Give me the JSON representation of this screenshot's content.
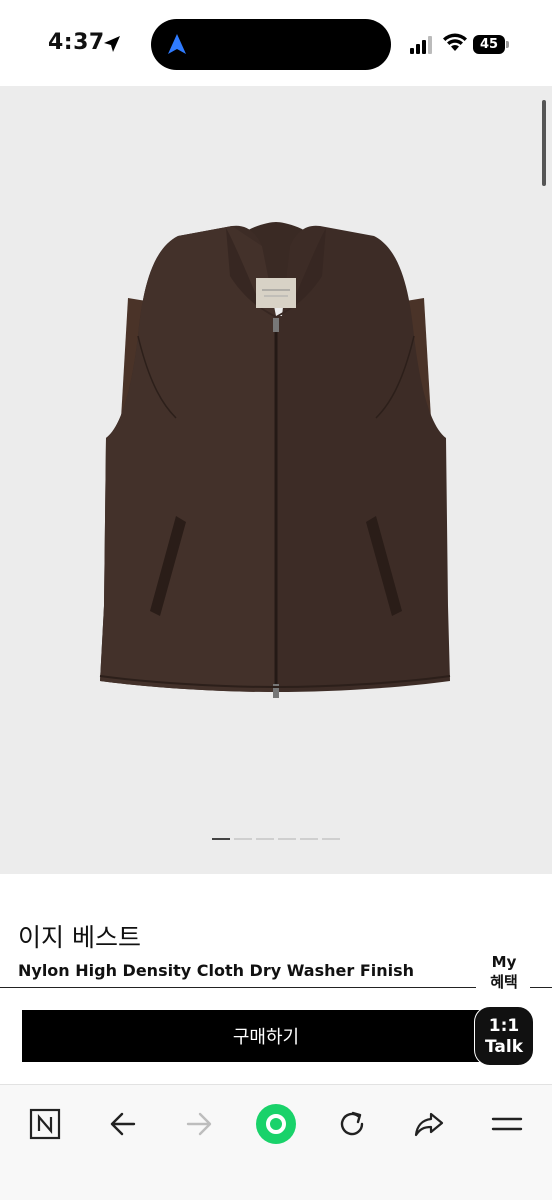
{
  "status_bar": {
    "time": "4:37",
    "battery": "45",
    "icons": [
      "location-arrow-icon",
      "navigation-arrow-icon",
      "cellular-signal-icon",
      "wifi-icon",
      "battery-icon"
    ]
  },
  "product": {
    "image_alt": "vest-photo",
    "pager_count": 6,
    "pager_active": 1,
    "title": "이지 베스트",
    "subtitle": "Nylon High Density Cloth Dry Washer Finish"
  },
  "floating": {
    "my_benefit_line1": "My",
    "my_benefit_line2": "혜택",
    "talk_line1": "1:1",
    "talk_line2": "Talk"
  },
  "actions": {
    "buy_label": "구매하기"
  },
  "toolbar": {
    "items": [
      "naver-n-icon",
      "back-arrow-icon",
      "forward-arrow-icon",
      "green-record-icon",
      "reload-icon",
      "share-icon",
      "menu-icon"
    ]
  },
  "colors": {
    "accent_green": "#19d26a",
    "island_blue": "#2f7bff",
    "vest_brown": "#3b2a24"
  }
}
